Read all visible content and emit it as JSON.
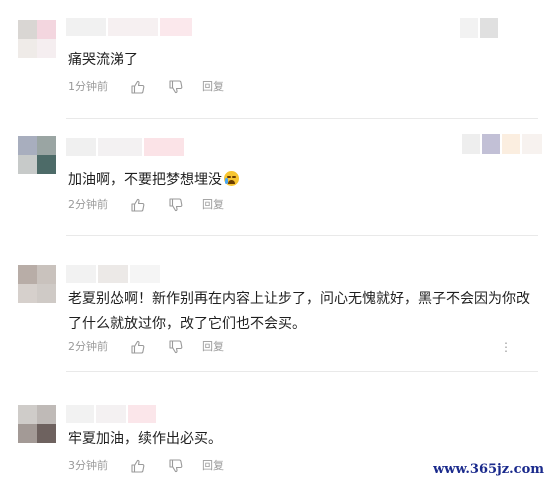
{
  "comments": [
    {
      "text": "痛哭流涕了",
      "time": "1分钟前",
      "reply": "回复",
      "emoji": ""
    },
    {
      "text": "加油啊，不要把梦想埋没",
      "time": "2分钟前",
      "reply": "回复",
      "emoji": "crying-face"
    },
    {
      "text": "老夏别怂啊！新作别再在内容上让步了，问心无愧就好，黑子不会因为你改了什么就放过你，改了它们也不会买。",
      "time": "2分钟前",
      "reply": "回复",
      "emoji": ""
    },
    {
      "text": "牢夏加油，续作出必买。",
      "time": "3分钟前",
      "reply": "回复",
      "emoji": ""
    }
  ],
  "comment3_more": "⋮",
  "watermark": "www.365jz.com",
  "icons": {
    "like": "thumbs-up-icon",
    "dislike": "thumbs-down-icon",
    "more": "more-vertical-icon",
    "emoji": "crying-face-icon"
  }
}
